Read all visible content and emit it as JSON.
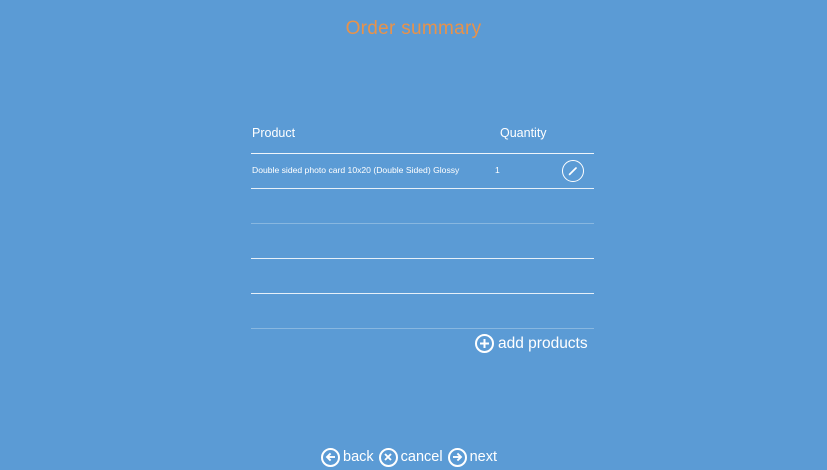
{
  "page": {
    "title": "Order summary",
    "accent_color": "#e8924a",
    "background_color": "#5b9bd5"
  },
  "table": {
    "headers": {
      "product": "Product",
      "quantity": "Quantity"
    },
    "rows": [
      {
        "product": "Double sided photo card 10x20 (Double Sided) Glossy",
        "quantity": "1",
        "action_icon": "pencil-icon"
      }
    ]
  },
  "add_products": {
    "label": "add products",
    "icon": "plus-circle-icon"
  },
  "footer": {
    "back_label": "back",
    "back_icon": "arrow-left-circle-icon",
    "cancel_label": "cancel",
    "cancel_icon": "x-circle-icon",
    "next_label": "next",
    "next_icon": "arrow-right-circle-icon"
  }
}
